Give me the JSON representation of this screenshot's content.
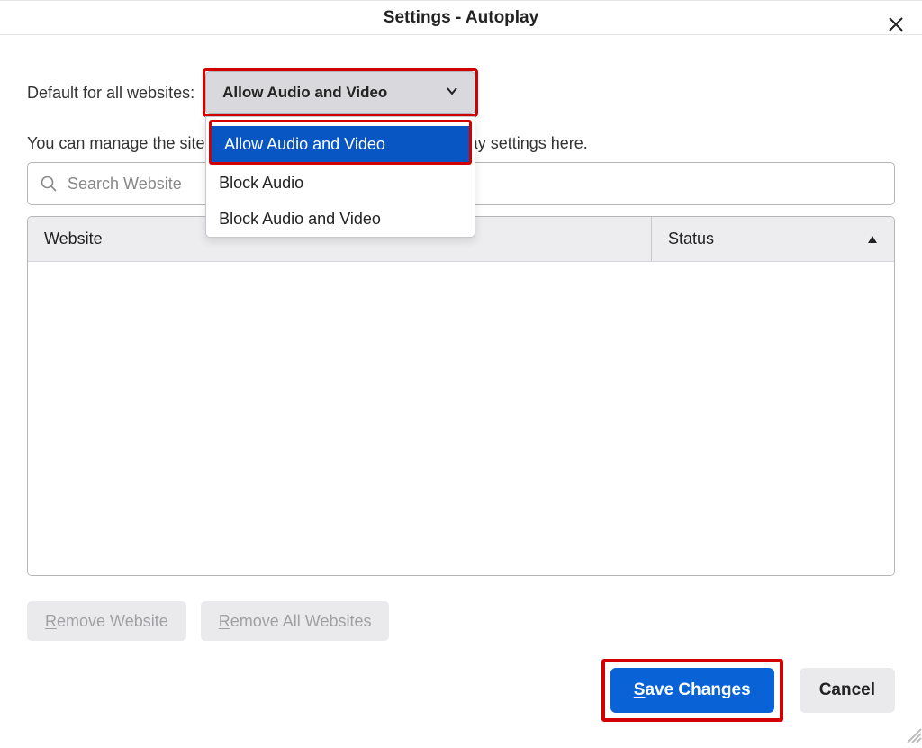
{
  "title": "Settings - Autoplay",
  "default_label": "Default for all websites:",
  "select": {
    "value": "Allow Audio and Video",
    "options": [
      "Allow Audio and Video",
      "Block Audio",
      "Block Audio and Video"
    ]
  },
  "description_full": "You can manage the sites that do not follow the default autoplay settings here.",
  "description_visible_suffix": "play settings here.",
  "search_placeholder": "Search Website",
  "columns": {
    "website": "Website",
    "status": "Status"
  },
  "buttons": {
    "remove_website": "Remove Website",
    "remove_all": "Remove All Websites",
    "save": "Save Changes",
    "cancel": "Cancel"
  },
  "accelerators": {
    "remove_website": "R",
    "remove_all": "R",
    "save": "S"
  },
  "sort": {
    "column": "status",
    "dir": "asc"
  },
  "highlight_color": "#d40000",
  "accent_color": "#0a63d6"
}
